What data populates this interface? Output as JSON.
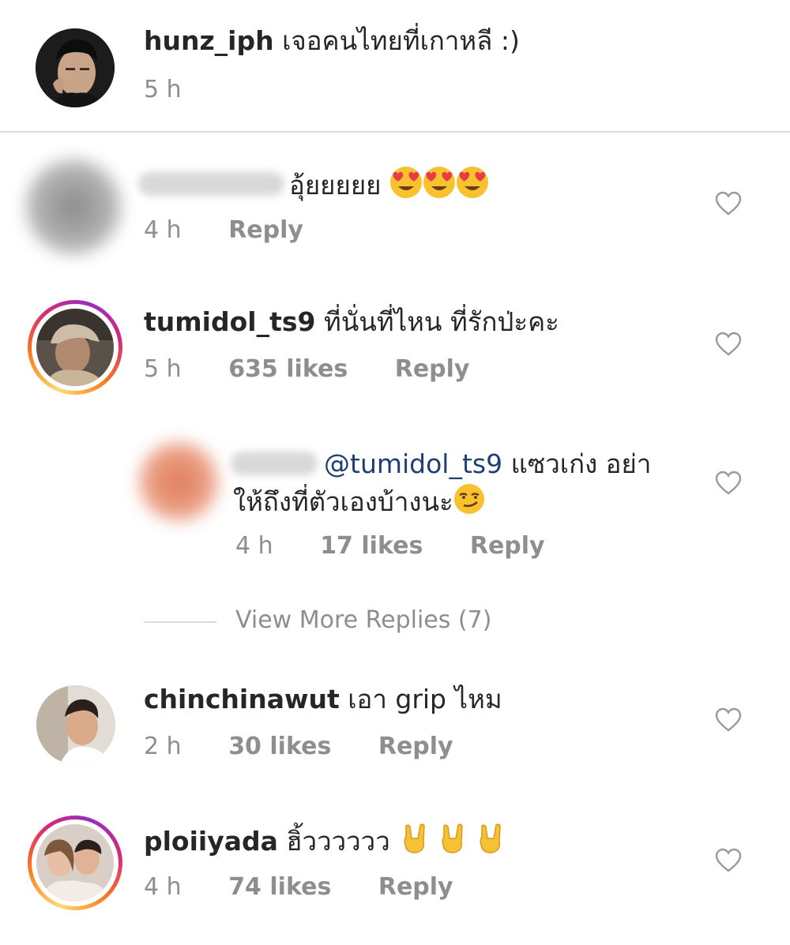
{
  "caption": {
    "username": "hunz_iph",
    "text": "เจอคนไทยที่เกาหลี :)",
    "time": "5 h"
  },
  "comments": [
    {
      "username": "",
      "text": "อุ้ยยยยย",
      "emoji": [
        "heart-eyes",
        "heart-eyes",
        "heart-eyes"
      ],
      "time": "4 h",
      "likes": "",
      "reply_label": "Reply"
    },
    {
      "username": "tumidol_ts9",
      "text": "ที่นั่นที่ไหน ที่รักป่ะคะ",
      "time": "5 h",
      "likes": "635 likes",
      "reply_label": "Reply"
    },
    {
      "username": "",
      "mention": "@tumidol_ts9",
      "text_line1": "แซวเก่ง อย่า",
      "text_line2": "ให้ถึงที่ตัวเองบ้างนะ",
      "emoji": [
        "smirk"
      ],
      "time": "4 h",
      "likes": "17 likes",
      "reply_label": "Reply"
    },
    {
      "username": "chinchinawut",
      "text": "เอา grip ไหม",
      "time": "2 h",
      "likes": "30 likes",
      "reply_label": "Reply"
    },
    {
      "username": "ploiiyada",
      "text": "ฮิ้วววววว",
      "emoji": [
        "rock-hand",
        "rock-hand",
        "rock-hand"
      ],
      "time": "4 h",
      "likes": "74 likes",
      "reply_label": "Reply"
    }
  ],
  "view_more_replies": "View More Replies (7)",
  "colors": {
    "text": "#262626",
    "meta": "#8e8e8e",
    "divider": "#dbdbdb",
    "mention": "#1f3f73"
  }
}
